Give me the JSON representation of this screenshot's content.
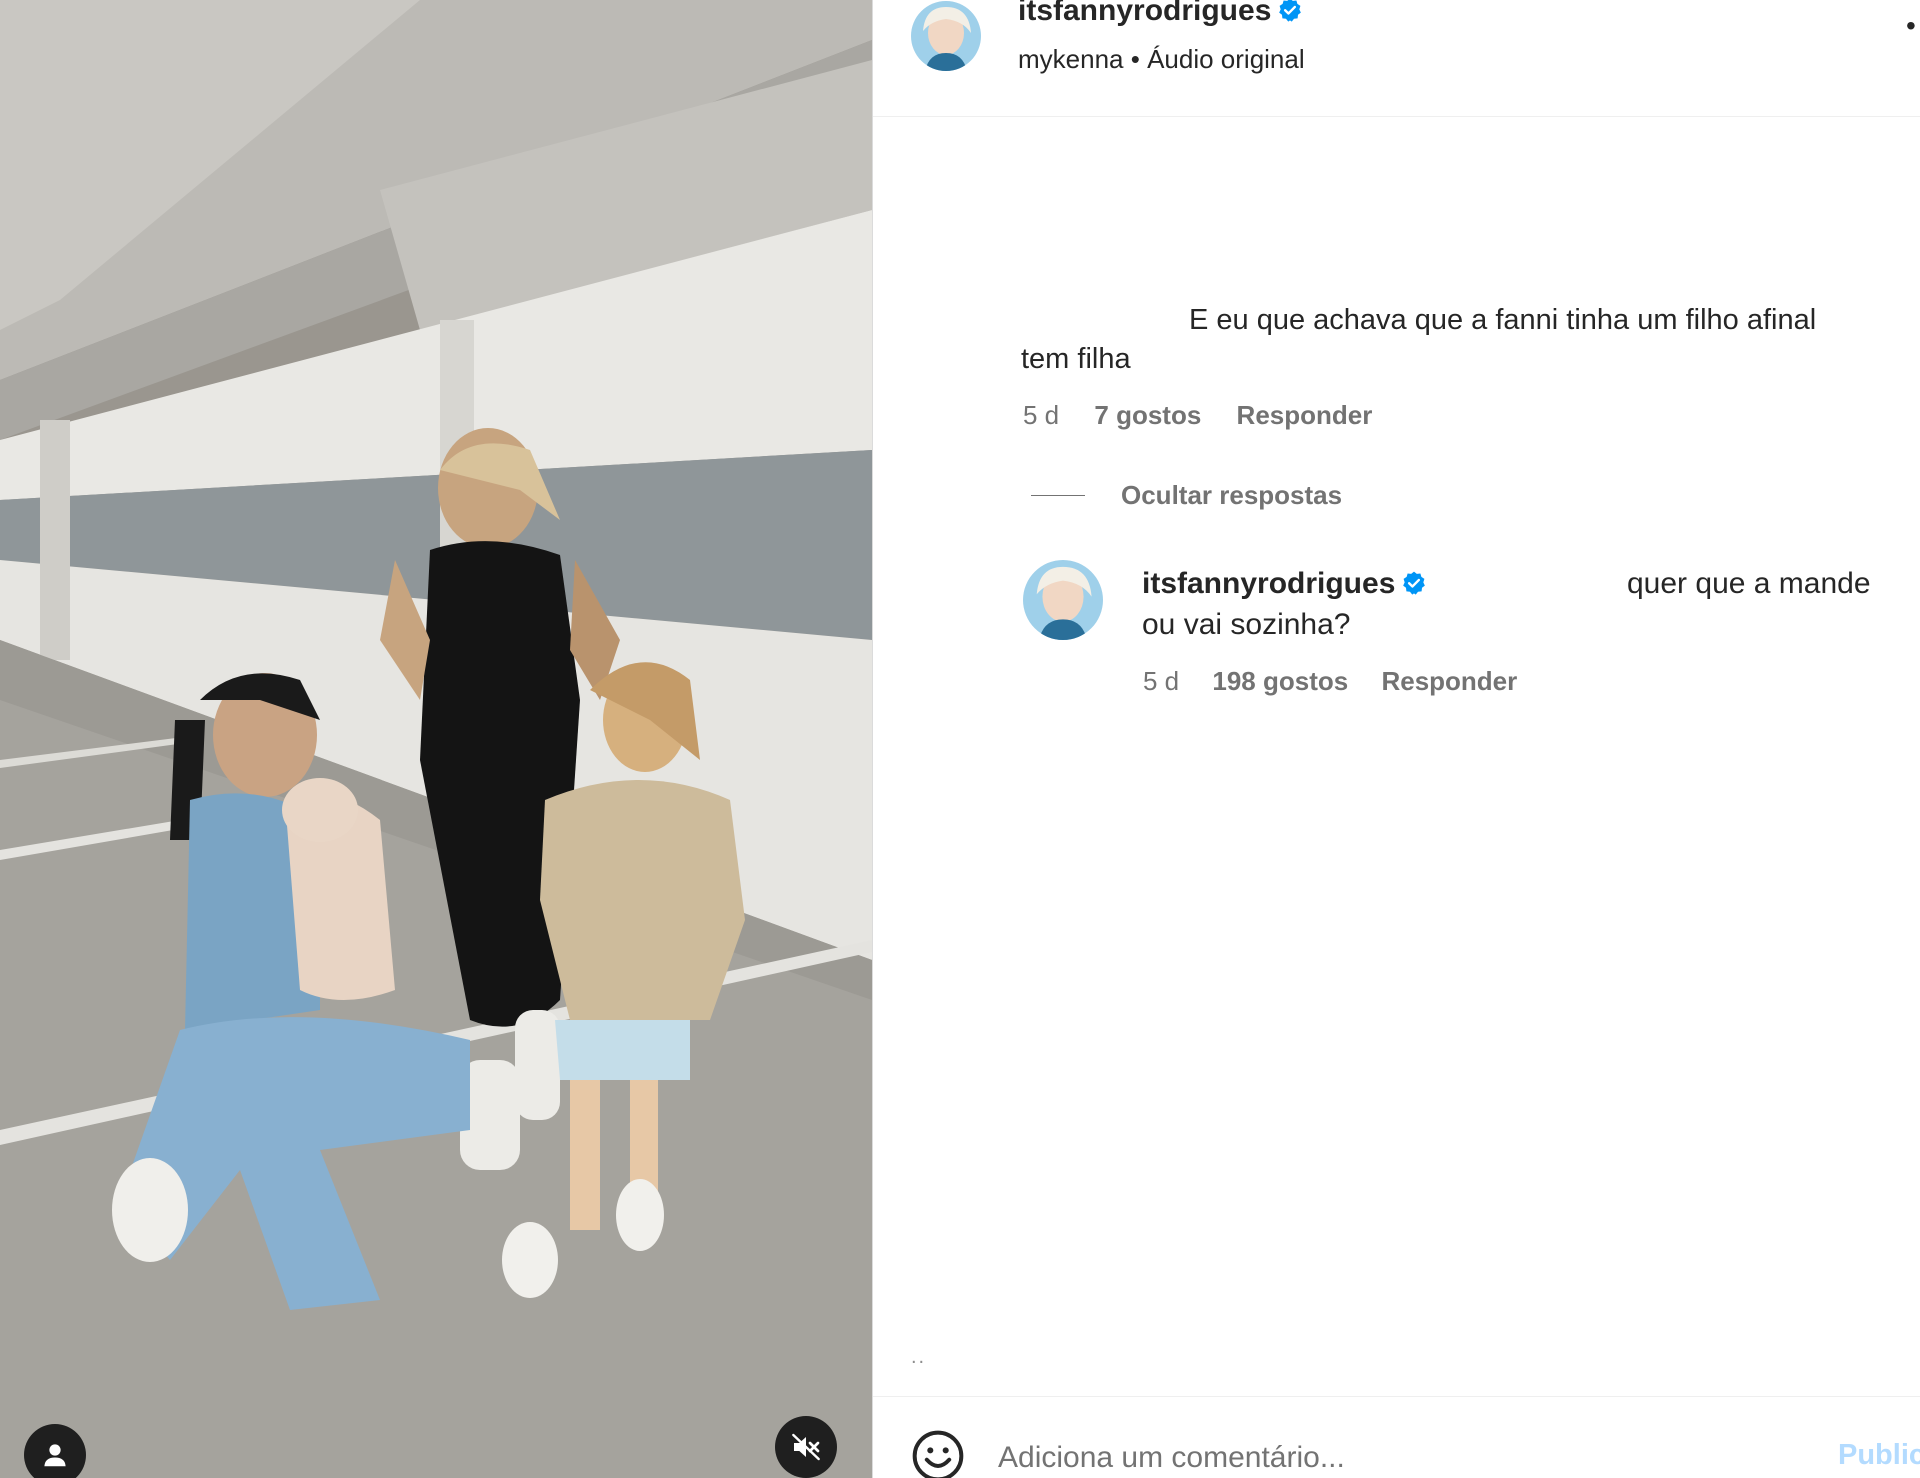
{
  "header": {
    "username": "itsfannyrodrigues",
    "audio_author": "mykenna",
    "separator": "•",
    "audio_label": "Áudio original",
    "more": "•"
  },
  "comment": {
    "text_line1": "E eu que achava que a fanni tinha um filho afinal",
    "text_line2": "tem filha",
    "time": "5 d",
    "likes": "7 gostos",
    "reply_label": "Responder"
  },
  "hide_replies": "Ocultar respostas",
  "reply": {
    "username": "itsfannyrodrigues",
    "text_line1": "quer que a mande",
    "text_line2": "ou vai sozinha?",
    "time": "5 d",
    "likes": "198 gostos",
    "reply_label": "Responder"
  },
  "footer": {
    "dots": "..",
    "placeholder": "Adiciona um comentário...",
    "publish_label": "Publicar"
  },
  "icons": {
    "tag": "user-tag-icon",
    "mute": "muted-speaker-icon",
    "verified": "verified-badge-icon",
    "emoji": "emoji-icon"
  },
  "colors": {
    "verified": "#0095f6",
    "publish": "#b3dbff",
    "secondary_text": "#737373"
  }
}
